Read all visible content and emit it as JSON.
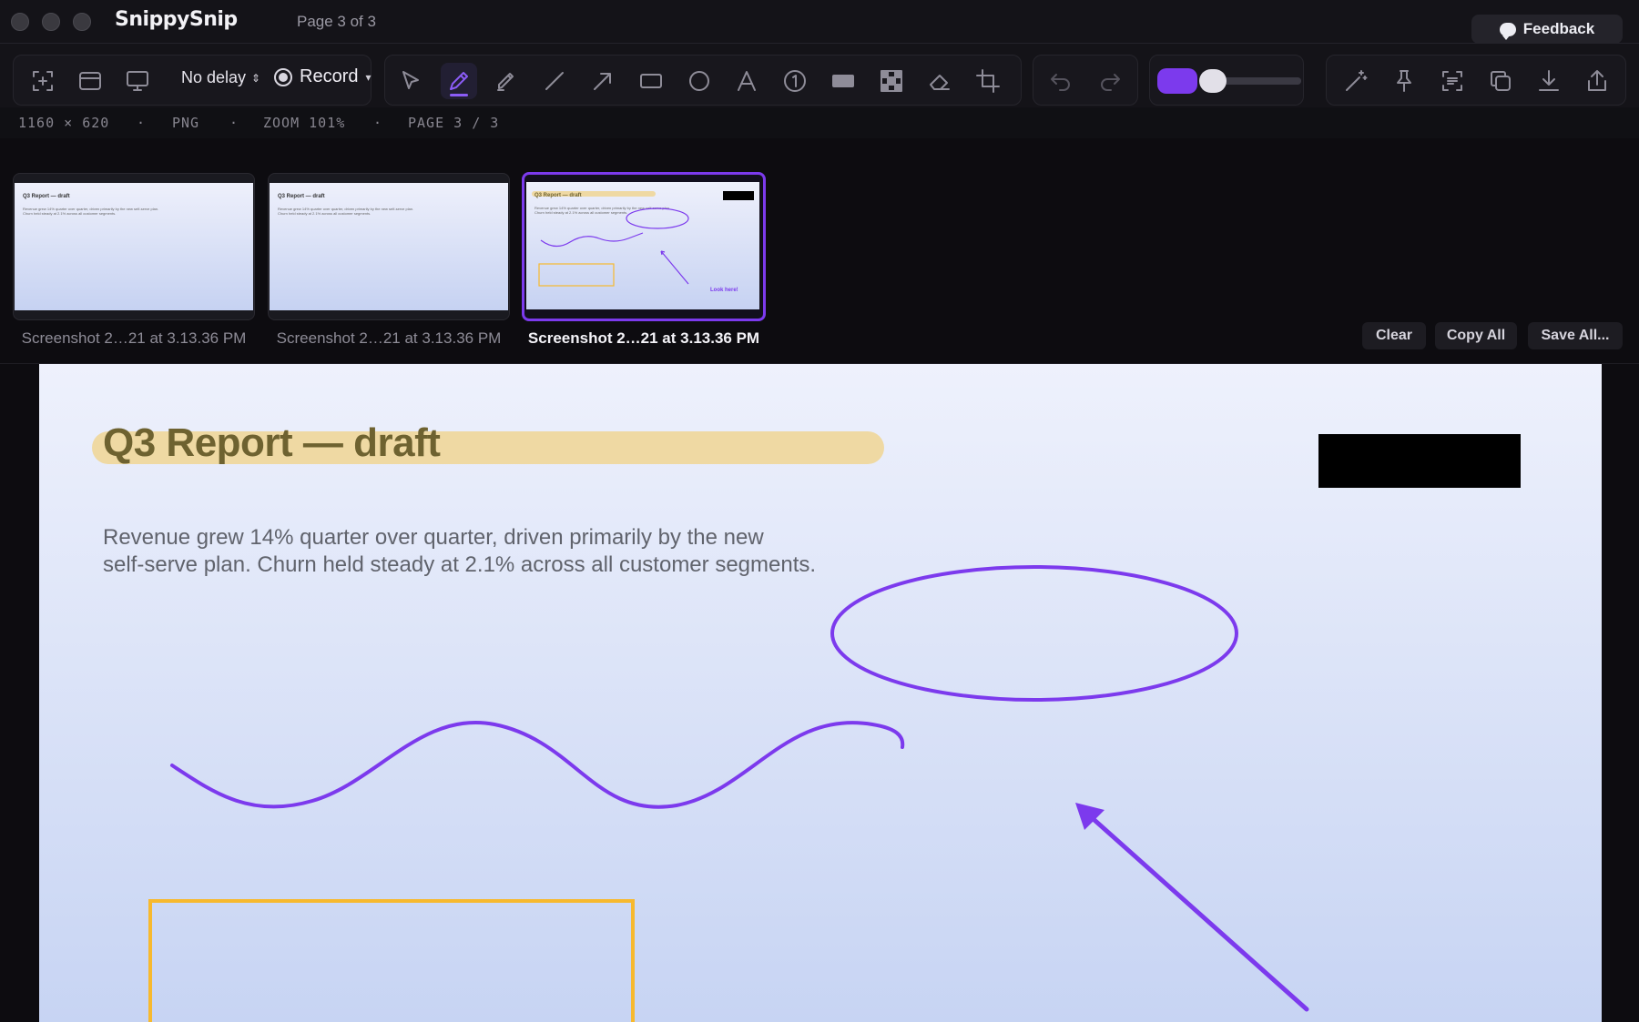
{
  "app": {
    "name": "SnippySnip",
    "page_indicator": "Page 3 of 3",
    "feedback_label": "Feedback"
  },
  "toolbar": {
    "delay": "No delay",
    "record_label": "Record",
    "active_tool": "pen",
    "stroke_color": "#7c3aed"
  },
  "status": {
    "dimensions": "1160 × 620",
    "format": "PNG",
    "zoom": "ZOOM 101%",
    "page": "PAGE 3 / 3",
    "separator": "·"
  },
  "thumbnails": [
    {
      "label": "Screenshot 2…21 at 3.13.36 PM",
      "title": "Q3 Report — draft",
      "body": "Revenue grew 14% quarter over quarter, driven primarily by the new self-serve plan. Churn held steady at 2.1% across all customer segments.",
      "selected": false
    },
    {
      "label": "Screenshot 2…21 at 3.13.36 PM",
      "title": "Q3 Report — draft",
      "body": "Revenue grew 14% quarter over quarter, driven primarily by the new self-serve plan. Churn held steady at 2.1% across all customer segments.",
      "selected": false
    },
    {
      "label": "Screenshot 2…21 at 3.13.36 PM",
      "title": "Q3 Report — draft",
      "body": "Revenue grew 14% quarter over quarter, driven primarily by the new self-serve plan. Churn held steady at 2.1% across all customer segments.",
      "annotation": "Look here!",
      "selected": true
    }
  ],
  "strip_actions": {
    "clear": "Clear",
    "copy_all": "Copy All",
    "save_all": "Save All..."
  },
  "document": {
    "title": "Q3 Report — draft",
    "body_line1": "Revenue grew 14% quarter over quarter, driven primarily by the new",
    "body_line2": "self-serve plan. Churn held steady at 2.1% across all customer segments."
  },
  "colors": {
    "accent": "#7c3aed",
    "highlight": "#efd9a3",
    "rectangle": "#f7b92e"
  }
}
